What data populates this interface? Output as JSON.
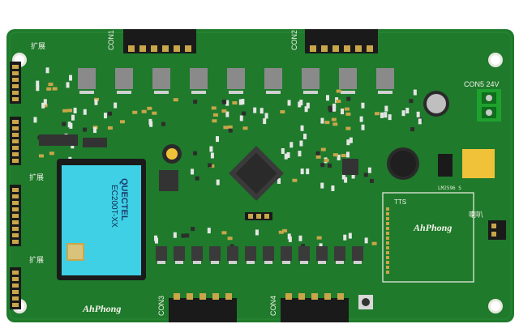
{
  "board": {
    "colors": {
      "board": "#1f7a2c",
      "board_dark": "#176222",
      "copper_pad": "#c9a64a",
      "silk": "#f2f2e8",
      "module_cyan": "#3fd0e6",
      "chip_black": "#2a2a2a",
      "header_black": "#1a1a1a"
    },
    "connectors": {
      "con1": "CON1",
      "con2": "CON2",
      "con3": "CON3",
      "con4": "CON4",
      "con5": "CON5 24V"
    },
    "module": {
      "brand": "QUECTEL",
      "model": "EC200T-XX"
    },
    "panel": {
      "title": "TTS",
      "brand": "AhPhong"
    },
    "brand_bottom": "AhPhong",
    "side_labels": {
      "left_top": "扩展",
      "left_mid": "扩展",
      "left_bottom": "扩展",
      "right": "喇叭"
    },
    "part_labels": {
      "regulator": "LM2596 S"
    }
  }
}
